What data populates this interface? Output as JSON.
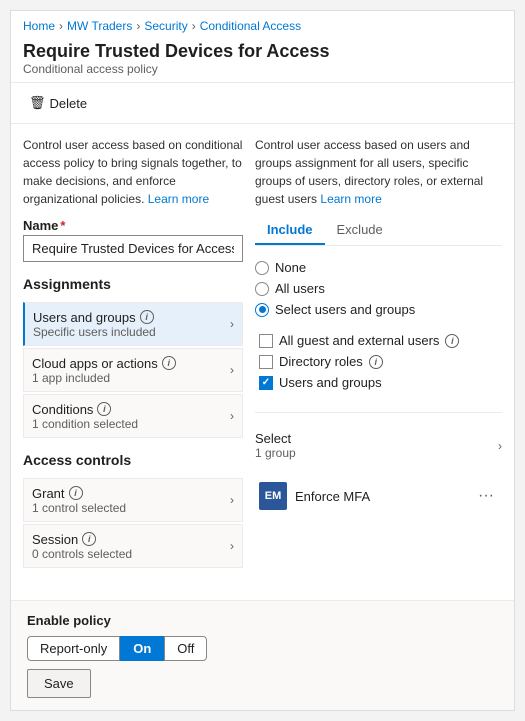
{
  "breadcrumb": {
    "items": [
      "Home",
      "MW Traders",
      "Security",
      "Conditional Access"
    ]
  },
  "header": {
    "title": "Require Trusted Devices for Access",
    "subtitle": "Conditional access policy"
  },
  "toolbar": {
    "delete_label": "Delete"
  },
  "left_panel": {
    "description": "Control user access based on conditional access policy to bring signals together, to make decisions, and enforce organizational policies.",
    "learn_more": "Learn more",
    "name_label": "Name",
    "name_value": "Require Trusted Devices for Access",
    "assignments_title": "Assignments",
    "assignments": [
      {
        "title": "Users and groups",
        "sub": "Specific users included",
        "active": true
      },
      {
        "title": "Cloud apps or actions",
        "sub": "1 app included",
        "active": false
      },
      {
        "title": "Conditions",
        "sub": "1 condition selected",
        "active": false
      }
    ],
    "access_controls_title": "Access controls",
    "access_controls": [
      {
        "title": "Grant",
        "sub": "1 control selected",
        "active": false
      },
      {
        "title": "Session",
        "sub": "0 controls selected",
        "active": false
      }
    ]
  },
  "right_panel": {
    "description": "Control user access based on users and groups assignment for all users, specific groups of users, directory roles, or external guest users",
    "learn_more": "Learn more",
    "tabs": [
      "Include",
      "Exclude"
    ],
    "active_tab": "Include",
    "radio_options": [
      {
        "label": "None",
        "selected": false
      },
      {
        "label": "All users",
        "selected": false
      },
      {
        "label": "Select users and groups",
        "selected": true
      }
    ],
    "checkboxes": [
      {
        "label": "All guest and external users",
        "checked": false,
        "has_info": true
      },
      {
        "label": "Directory roles",
        "checked": false,
        "has_info": true
      },
      {
        "label": "Users and groups",
        "checked": true,
        "has_info": false
      }
    ],
    "select_label": "Select",
    "select_sub": "1 group",
    "group": {
      "initials": "EM",
      "name": "Enforce MFA"
    }
  },
  "footer": {
    "enable_policy_label": "Enable policy",
    "toggle_options": [
      "Report-only",
      "On",
      "Off"
    ],
    "active_toggle": "On",
    "save_label": "Save"
  },
  "icons": {
    "delete_icon": "🗑",
    "info_icon": "i",
    "chevron": "›",
    "ellipsis": "···"
  }
}
